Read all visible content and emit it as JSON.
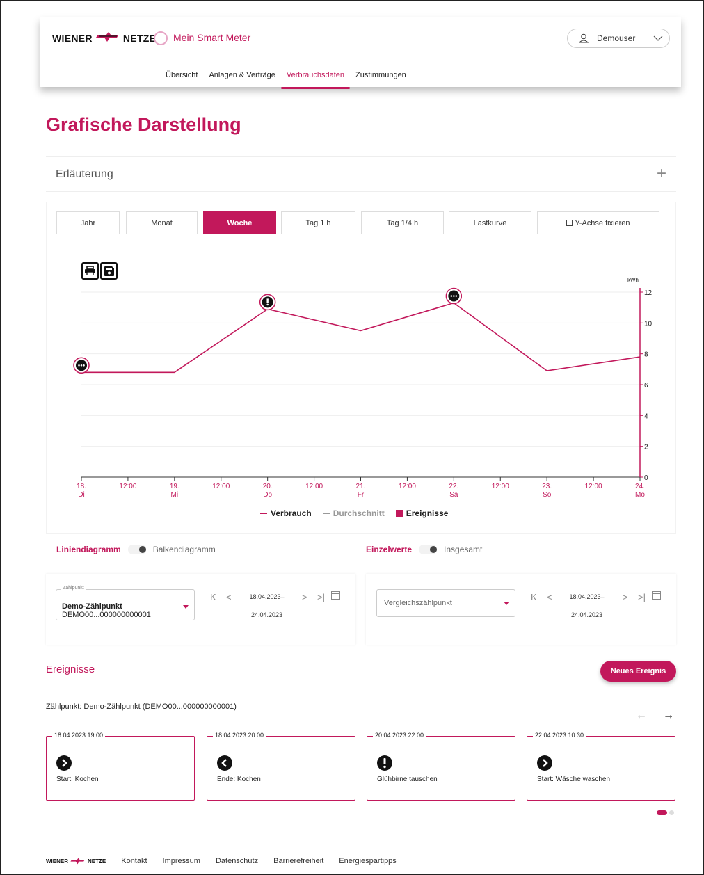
{
  "header": {
    "logo_left": "WIENER",
    "logo_right": "NETZE",
    "app_title": "Mein Smart Meter",
    "user_name": "Demouser",
    "nav": [
      "Übersicht",
      "Anlagen & Verträge",
      "Verbrauchsdaten",
      "Zustimmungen"
    ],
    "active_nav": "Verbrauchsdaten"
  },
  "page_title": "Grafische Darstellung",
  "erlaeuterung": {
    "label": "Erläuterung",
    "expand_icon": "plus-icon"
  },
  "tabs": [
    "Jahr",
    "Monat",
    "Woche",
    "Tag 1 h",
    "Tag 1/4 h",
    "Lastkurve"
  ],
  "active_tab": "Woche",
  "y_axis_fix_label": "Y-Achse fixieren",
  "tools": {
    "print": "print-icon",
    "save": "save-icon"
  },
  "chart_data": {
    "type": "line",
    "ylabel": "kWh",
    "ylim": [
      0,
      12
    ],
    "yticks": [
      "0",
      "2",
      "4",
      "6",
      "8",
      "10",
      "12"
    ],
    "x_ticks": [
      {
        "l1": "18.",
        "l2": "Di"
      },
      {
        "l1": "12:00",
        "l2": ""
      },
      {
        "l1": "19.",
        "l2": "Mi"
      },
      {
        "l1": "12:00",
        "l2": ""
      },
      {
        "l1": "20.",
        "l2": "Do"
      },
      {
        "l1": "12:00",
        "l2": ""
      },
      {
        "l1": "21.",
        "l2": "Fr"
      },
      {
        "l1": "12:00",
        "l2": ""
      },
      {
        "l1": "22.",
        "l2": "Sa"
      },
      {
        "l1": "12:00",
        "l2": ""
      },
      {
        "l1": "23.",
        "l2": "So"
      },
      {
        "l1": "12:00",
        "l2": ""
      },
      {
        "l1": "24.",
        "l2": "Mo"
      }
    ],
    "series": [
      {
        "name": "Verbrauch",
        "color": "#c2185b",
        "points": [
          [
            0,
            6.8
          ],
          [
            1,
            6.8
          ],
          [
            2,
            10.9
          ],
          [
            3,
            9.5
          ],
          [
            4,
            11.3
          ],
          [
            5,
            6.9
          ],
          [
            6,
            7.8
          ]
        ]
      }
    ],
    "events": [
      {
        "x": 0,
        "y": 6.8,
        "icon": "more-icon"
      },
      {
        "x": 2,
        "y": 10.9,
        "icon": "exclamation-icon"
      },
      {
        "x": 4,
        "y": 11.3,
        "icon": "more-icon"
      }
    ],
    "legend": [
      "Verbrauch",
      "Durchschnitt",
      "Ereignisse"
    ],
    "grid": true
  },
  "toggles": {
    "left_on": "Liniendiagramm",
    "left_off": "Balkendiagramm",
    "right_on": "Einzelwerte",
    "right_off": "Insgesamt"
  },
  "zaehlpunkt": {
    "label": "Zählpunkt",
    "name": "Demo-Zählpunkt",
    "id": "DEMO00...000000000001",
    "date_from": "18.04.2023–",
    "date_to": "24.04.2023"
  },
  "vergleich": {
    "placeholder": "Vergleichszählpunkt",
    "date_from": "18.04.2023–",
    "date_to": "24.04.2023"
  },
  "ereignisse": {
    "title": "Ereignisse",
    "new_button": "Neues Ereignis",
    "zaehlpunkt_line": "Zählpunkt: Demo-Zählpunkt (DEMO00...000000000001)",
    "cards": [
      {
        "date": "18.04.2023 19:00",
        "label": "Start: Kochen",
        "icon": "chevron-right-circle-icon"
      },
      {
        "date": "18.04.2023 20:00",
        "label": "Ende: Kochen",
        "icon": "chevron-left-circle-icon"
      },
      {
        "date": "20.04.2023 22:00",
        "label": "Glühbirne tauschen",
        "icon": "exclamation-circle-icon"
      },
      {
        "date": "22.04.2023 10:30",
        "label": "Start: Wäsche waschen",
        "icon": "chevron-right-circle-icon"
      }
    ]
  },
  "footer": {
    "logo_left": "WIENER",
    "logo_right": "NETZE",
    "links": [
      "Kontakt",
      "Impressum",
      "Datenschutz",
      "Barrierefreiheit",
      "Energiespartipps"
    ]
  }
}
